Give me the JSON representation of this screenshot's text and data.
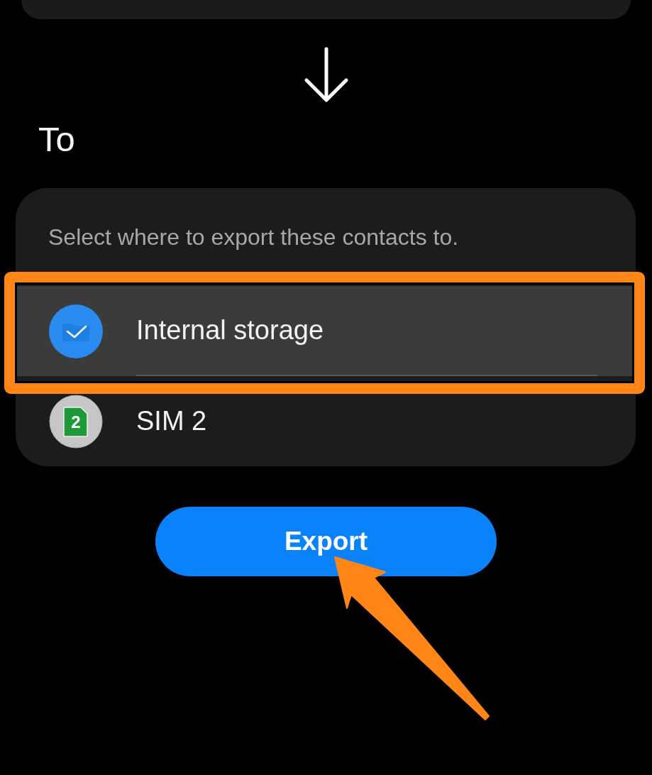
{
  "header": {
    "title": "To"
  },
  "destination_card": {
    "prompt": "Select where to export these contacts to.",
    "options": [
      {
        "kind": "storage",
        "label": "Internal storage",
        "selected": true,
        "annotated": true
      },
      {
        "kind": "sim",
        "label": "SIM 2",
        "badge": "2",
        "selected": false,
        "annotated": false
      }
    ]
  },
  "export_button": {
    "label": "Export",
    "annotated": true
  }
}
